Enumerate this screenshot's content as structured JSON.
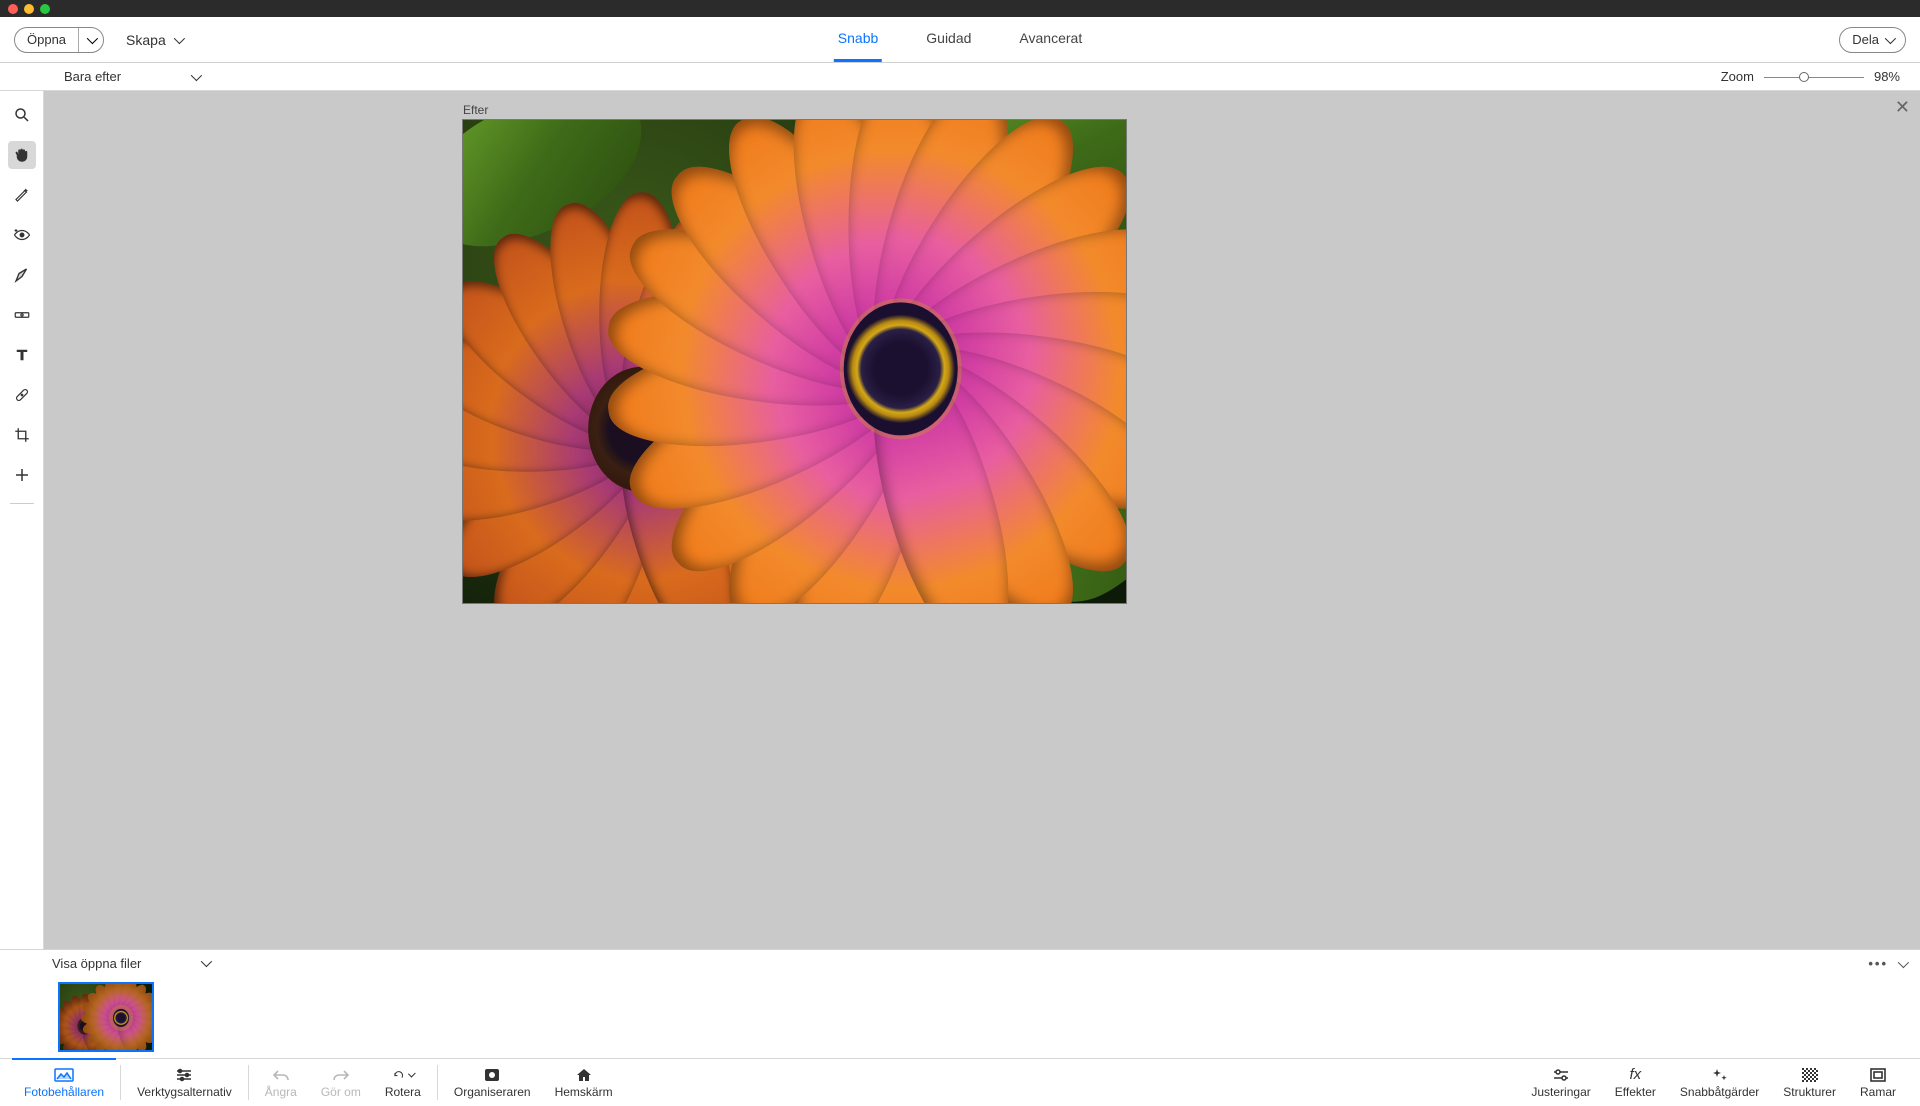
{
  "toolbar": {
    "open_label": "Öppna",
    "create_label": "Skapa",
    "share_label": "Dela"
  },
  "tabs": {
    "quick": "Snabb",
    "guided": "Guidad",
    "advanced": "Avancerat"
  },
  "subbar": {
    "view_mode": "Bara efter",
    "zoom_label": "Zoom",
    "zoom_value": "98%",
    "zoom_percent": 40
  },
  "canvas": {
    "label": "Efter"
  },
  "photobin": {
    "header": "Visa öppna filer"
  },
  "bottombar": {
    "left": {
      "photo_bin": "Fotobehållaren",
      "tool_options": "Verktygsalternativ"
    },
    "center": {
      "undo": "Ångra",
      "redo": "Gör om",
      "rotate": "Rotera",
      "organizer": "Organiseraren",
      "home": "Hemskärm"
    },
    "right": {
      "adjustments": "Justeringar",
      "effects": "Effekter",
      "quick_actions": "Snabbåtgärder",
      "textures": "Strukturer",
      "frames": "Ramar"
    }
  }
}
